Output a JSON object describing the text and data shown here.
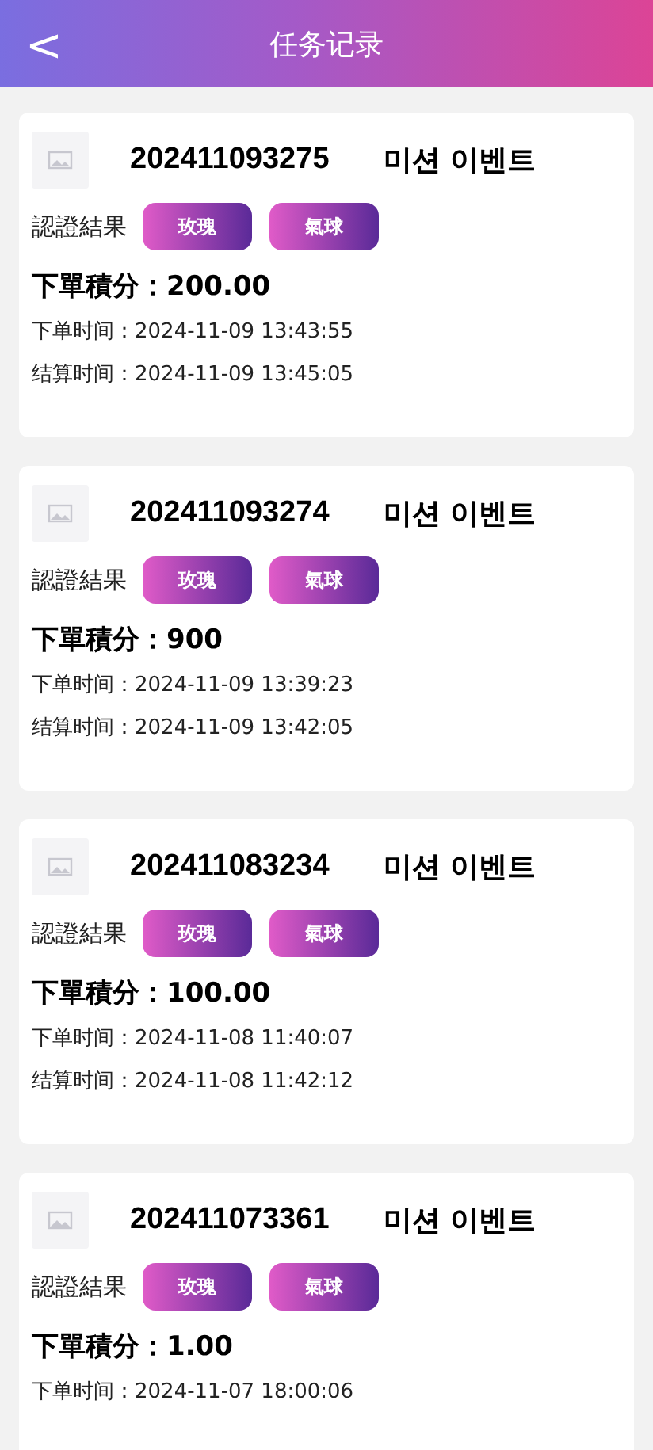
{
  "header": {
    "back": "<",
    "title": "任务记录"
  },
  "records": [
    {
      "order_no": "202411093275",
      "title": "미션 이벤트",
      "result_label": "認證結果",
      "tags": [
        "玫瑰",
        "氣球"
      ],
      "points": "下單積分：200.00",
      "order_time": "下单时间：2024-11-09 13:43:55",
      "settle_time": "结算时间：2024-11-09 13:45:05"
    },
    {
      "order_no": "202411093274",
      "title": "미션 이벤트",
      "result_label": "認證結果",
      "tags": [
        "玫瑰",
        "氣球"
      ],
      "points": "下單積分：900",
      "order_time": "下单时间：2024-11-09 13:39:23",
      "settle_time": "结算时间：2024-11-09 13:42:05"
    },
    {
      "order_no": "202411083234",
      "title": "미션 이벤트",
      "result_label": "認證結果",
      "tags": [
        "玫瑰",
        "氣球"
      ],
      "points": "下單積分：100.00",
      "order_time": "下单时间：2024-11-08 11:40:07",
      "settle_time": "结算时间：2024-11-08 11:42:12"
    },
    {
      "order_no": "202411073361",
      "title": "미션 이벤트",
      "result_label": "認證結果",
      "tags": [
        "玫瑰",
        "氣球"
      ],
      "points": "下單積分：1.00",
      "order_time": "下单时间：2024-11-07 18:00:06"
    }
  ]
}
